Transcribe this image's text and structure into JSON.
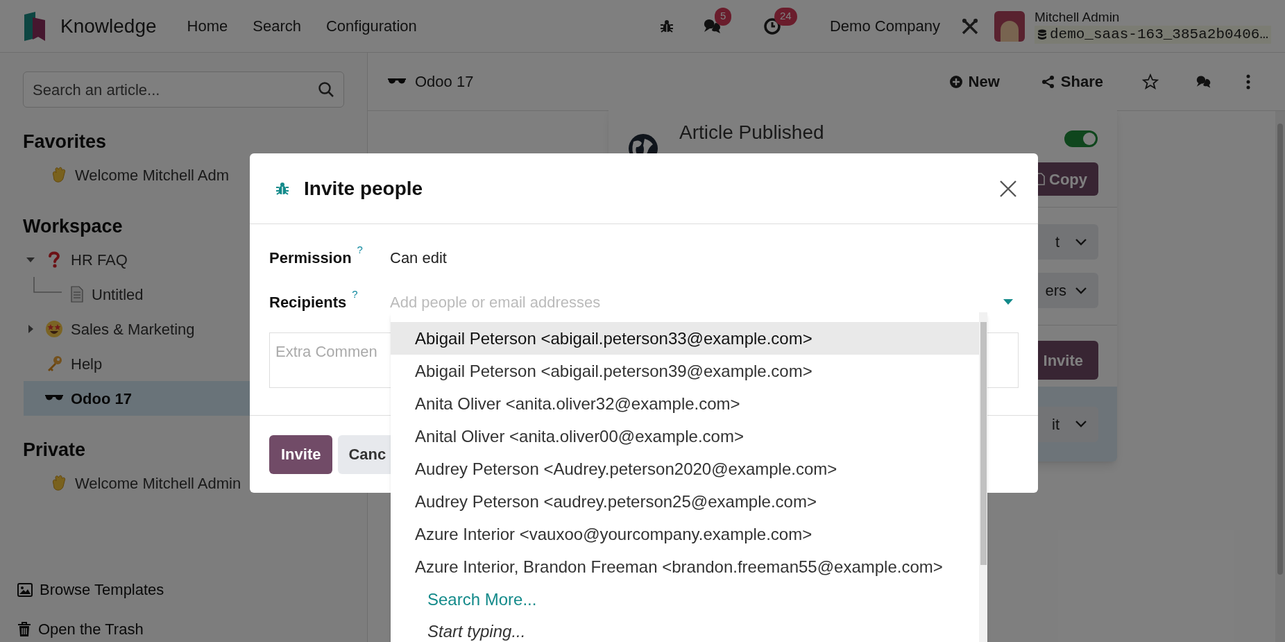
{
  "navbar": {
    "app_name": "Knowledge",
    "menu": [
      "Home",
      "Search",
      "Configuration"
    ],
    "messages_badge": "5",
    "activities_badge": "24",
    "company": "Demo Company",
    "user": "Mitchell Admin",
    "database": "demo_saas-163_385a2b0406…"
  },
  "sidebar": {
    "search_placeholder": "Search an article...",
    "sections": [
      {
        "title": "Favorites",
        "items": [
          {
            "kind": "wave",
            "label": "Welcome Mitchell Adm",
            "selected": false
          }
        ]
      },
      {
        "title": "Workspace",
        "items": [
          {
            "kind": "question",
            "label": "HR FAQ",
            "expanded": true,
            "selected": false,
            "children": [
              {
                "kind": "document",
                "label": "Untitled",
                "selected": false
              }
            ]
          },
          {
            "kind": "star-eyes",
            "label": "Sales & Marketing",
            "expanded": false,
            "selected": false
          },
          {
            "kind": "key",
            "label": "Help",
            "selected": false
          },
          {
            "kind": "sunglasses",
            "label": "Odoo 17",
            "selected": true
          }
        ]
      },
      {
        "title": "Private",
        "items": [
          {
            "kind": "wave",
            "label": "Welcome Mitchell Admin",
            "selected": false
          }
        ]
      }
    ],
    "footer": [
      {
        "kind": "image",
        "label": "Browse Templates"
      },
      {
        "kind": "trash",
        "label": "Open the Trash"
      }
    ]
  },
  "header": {
    "article": "Odoo 17",
    "new_button": "New",
    "share_button": "Share"
  },
  "share_panel": {
    "title": "Article Published",
    "published": true,
    "copy_button": "Copy",
    "field_1": "t",
    "field_2": "ers",
    "invite_button": "Invite",
    "member_permission": "it"
  },
  "dialog": {
    "title": "Invite people",
    "permission": {
      "label": "Permission",
      "help": "?",
      "value": "Can edit"
    },
    "recipients": {
      "label": "Recipients",
      "help": "?",
      "placeholder": "Add people or email addresses"
    },
    "comment_placeholder": "Extra Commen",
    "invite_button": "Invite",
    "cancel_button": "Canc"
  },
  "dropdown": {
    "options": [
      {
        "label": "Abigail Peterson <abigail.peterson33@example.com>",
        "selected": true
      },
      {
        "label": "Abigail Peterson <abigail.peterson39@example.com>",
        "selected": false
      },
      {
        "label": "Anita Oliver <anita.oliver32@example.com>",
        "selected": false
      },
      {
        "label": "Anital Oliver <anita.oliver00@example.com>",
        "selected": false
      },
      {
        "label": "Audrey Peterson <Audrey.peterson2020@example.com>",
        "selected": false
      },
      {
        "label": "Audrey Peterson <audrey.peterson25@example.com>",
        "selected": false
      },
      {
        "label": "Azure Interior <vauxoo@yourcompany.example.com>",
        "selected": false
      },
      {
        "label": "Azure Interior, Brandon Freeman <brandon.freeman55@example.com>",
        "selected": false
      }
    ],
    "search_more": "Search More...",
    "hint": "Start typing..."
  }
}
